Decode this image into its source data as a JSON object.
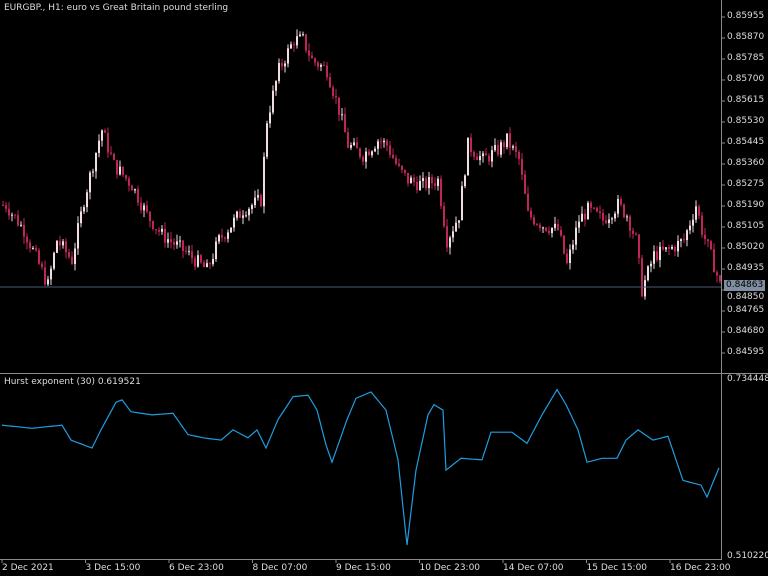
{
  "header": {
    "title": "EURGBP., H1:  euro vs Great Britain pound sterling"
  },
  "price_axis": {
    "labels": [
      "0.85955",
      "0.85870",
      "0.85785",
      "0.85700",
      "0.85615",
      "0.85530",
      "0.85445",
      "0.85360",
      "0.85275",
      "0.85190",
      "0.85105",
      "0.85020",
      "0.84935",
      "0.84850",
      "0.84765",
      "0.84680",
      "0.84595"
    ],
    "max": 0.85955,
    "step": 0.00085
  },
  "current_price": "0.84863",
  "time_axis": {
    "labels": [
      "2 Dec 2021",
      "3 Dec 15:00",
      "6 Dec 23:00",
      "8 Dec 07:00",
      "9 Dec 15:00",
      "10 Dec 23:00",
      "14 Dec 07:00",
      "15 Dec 15:00",
      "16 Dec 23:00"
    ]
  },
  "indicator": {
    "title": "Hurst exponent (30) 0.619521",
    "max_label": "0.734448",
    "min_label": "0.510220",
    "max": 0.734448,
    "min": 0.51022
  },
  "colors": {
    "up": "#f0dce4",
    "down": "#c0255a",
    "line": "#1e9ee0",
    "grid": "#8a8a8a"
  },
  "chart_data": [
    {
      "type": "candlestick",
      "title": "EURGBP H1",
      "bars": 240,
      "key_closes": [
        [
          1,
          0.85194
        ],
        [
          7,
          0.85093
        ],
        [
          15,
          0.8487
        ],
        [
          18,
          0.85052
        ],
        [
          23,
          0.84971
        ],
        [
          27,
          0.85214
        ],
        [
          32,
          0.85457
        ],
        [
          33,
          0.85498
        ],
        [
          37,
          0.85356
        ],
        [
          43,
          0.85275
        ],
        [
          48,
          0.85154
        ],
        [
          53,
          0.85073
        ],
        [
          60,
          0.85012
        ],
        [
          68,
          0.84931
        ],
        [
          72,
          0.85052
        ],
        [
          80,
          0.85174
        ],
        [
          86,
          0.85214
        ],
        [
          88,
          0.85538
        ],
        [
          92,
          0.85741
        ],
        [
          97,
          0.85862
        ],
        [
          100,
          0.85862
        ],
        [
          103,
          0.85781
        ],
        [
          108,
          0.85741
        ],
        [
          112,
          0.85579
        ],
        [
          115,
          0.85437
        ],
        [
          120,
          0.85396
        ],
        [
          125,
          0.85457
        ],
        [
          128,
          0.85437
        ],
        [
          132,
          0.85336
        ],
        [
          135,
          0.85295
        ],
        [
          140,
          0.85275
        ],
        [
          145,
          0.85295
        ],
        [
          148,
          0.85052
        ],
        [
          152,
          0.85154
        ],
        [
          155,
          0.85437
        ],
        [
          160,
          0.85376
        ],
        [
          165,
          0.85417
        ],
        [
          168,
          0.85457
        ],
        [
          172,
          0.85376
        ],
        [
          175,
          0.85154
        ],
        [
          180,
          0.85113
        ],
        [
          185,
          0.85093
        ],
        [
          188,
          0.84951
        ],
        [
          192,
          0.85133
        ],
        [
          195,
          0.85174
        ],
        [
          200,
          0.85133
        ],
        [
          205,
          0.85194
        ],
        [
          208,
          0.85154
        ],
        [
          211,
          0.85052
        ],
        [
          213,
          0.8485
        ],
        [
          217,
          0.84991
        ],
        [
          222,
          0.85012
        ],
        [
          227,
          0.85052
        ],
        [
          231,
          0.85194
        ],
        [
          233,
          0.85093
        ],
        [
          237,
          0.84951
        ],
        [
          239,
          0.8487
        ]
      ]
    },
    {
      "type": "line",
      "title": "Hurst exponent (30)",
      "ylim": [
        0.51022,
        0.734448
      ],
      "points": [
        [
          0,
          0.676
        ],
        [
          10,
          0.672
        ],
        [
          20,
          0.676
        ],
        [
          23,
          0.657
        ],
        [
          30,
          0.647
        ],
        [
          33,
          0.67
        ],
        [
          38,
          0.705
        ],
        [
          40,
          0.708
        ],
        [
          43,
          0.693
        ],
        [
          50,
          0.689
        ],
        [
          57,
          0.691
        ],
        [
          62,
          0.664
        ],
        [
          67,
          0.66
        ],
        [
          73,
          0.657
        ],
        [
          77,
          0.67
        ],
        [
          82,
          0.66
        ],
        [
          85,
          0.67
        ],
        [
          88,
          0.647
        ],
        [
          92,
          0.683
        ],
        [
          97,
          0.712
        ],
        [
          102,
          0.714
        ],
        [
          105,
          0.695
        ],
        [
          108,
          0.651
        ],
        [
          110,
          0.629
        ],
        [
          115,
          0.683
        ],
        [
          118,
          0.71
        ],
        [
          123,
          0.718
        ],
        [
          128,
          0.695
        ],
        [
          132,
          0.632
        ],
        [
          135,
          0.524
        ],
        [
          138,
          0.619
        ],
        [
          142,
          0.689
        ],
        [
          144,
          0.702
        ],
        [
          147,
          0.695
        ],
        [
          148,
          0.619
        ],
        [
          153,
          0.634
        ],
        [
          160,
          0.632
        ],
        [
          163,
          0.667
        ],
        [
          170,
          0.667
        ],
        [
          175,
          0.653
        ],
        [
          180,
          0.689
        ],
        [
          185,
          0.721
        ],
        [
          188,
          0.702
        ],
        [
          192,
          0.67
        ],
        [
          195,
          0.629
        ],
        [
          200,
          0.634
        ],
        [
          205,
          0.634
        ],
        [
          208,
          0.657
        ],
        [
          212,
          0.67
        ],
        [
          217,
          0.657
        ],
        [
          222,
          0.662
        ],
        [
          227,
          0.606
        ],
        [
          233,
          0.6
        ],
        [
          235,
          0.585
        ],
        [
          239,
          0.622
        ]
      ]
    }
  ]
}
